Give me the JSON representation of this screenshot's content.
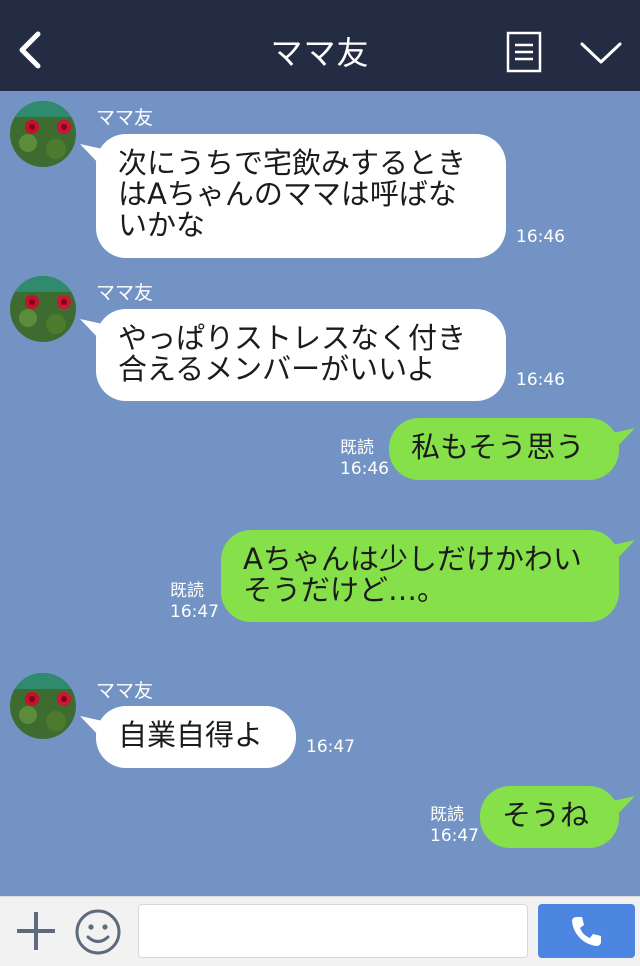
{
  "header": {
    "title": "ママ友"
  },
  "messages": [
    {
      "sender": "ママ友",
      "lines": [
        "次にうちで宅飲みするとき",
        "はAちゃんのママは呼ばな",
        "いかな"
      ],
      "time": "16:46"
    },
    {
      "sender": "ママ友",
      "lines": [
        "やっぱりストレスなく付き",
        "合えるメンバーがいいよ"
      ],
      "time": "16:46"
    },
    {
      "read": "既読",
      "lines": [
        "私もそう思う"
      ],
      "time": "16:46"
    },
    {
      "read": "既読",
      "lines": [
        "Aちゃんは少しだけかわい",
        "そうだけど…。"
      ],
      "time": "16:47"
    },
    {
      "sender": "ママ友",
      "lines": [
        "自業自得よ"
      ],
      "time": "16:47"
    },
    {
      "read": "既読",
      "lines": [
        "そうね"
      ],
      "time": "16:47"
    }
  ],
  "footer": {
    "input_value": ""
  },
  "colors": {
    "header": "#242c44",
    "chat_bg": "#7293c3",
    "incoming": "#ffffff",
    "outgoing": "#86e04a",
    "call_button": "#4d86e0"
  },
  "icons": [
    "back-chevron-icon",
    "notes-icon",
    "chevron-down-icon",
    "plus-icon",
    "smiley-icon",
    "phone-icon",
    "avatar-flower-image"
  ]
}
